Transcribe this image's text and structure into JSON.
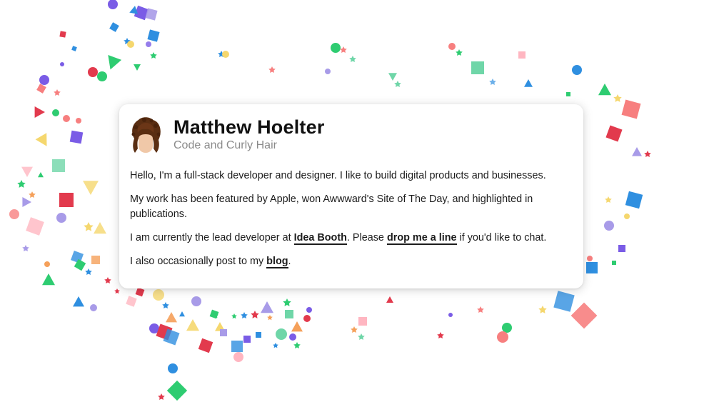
{
  "profile": {
    "name": "Matthew Hoelter",
    "tagline": "Code and Curly Hair",
    "avatar_icon": "curly-hair-avatar-icon"
  },
  "bio": {
    "p1": "Hello, I'm a full-stack developer and designer. I like to build digital products and businesses.",
    "p2": "My work has been featured by Apple, won Awwward's Site of The Day, and highlighted in publications.",
    "p3": {
      "before": "I am currently the lead developer at ",
      "link1": "Idea Booth",
      "middle": ". Please ",
      "link2": "drop me a line",
      "after": " if you'd like to chat."
    },
    "p4": {
      "before": "I also occasionally post to my ",
      "link": "blog",
      "after": "."
    }
  },
  "colors": {
    "confetti": [
      "#e23a4d",
      "#2f8fe0",
      "#2ecc71",
      "#7a5ce6",
      "#f5a05a",
      "#f5d76e",
      "#6fd6a8",
      "#f77f7f",
      "#a89be8",
      "#ffb6c1"
    ]
  }
}
